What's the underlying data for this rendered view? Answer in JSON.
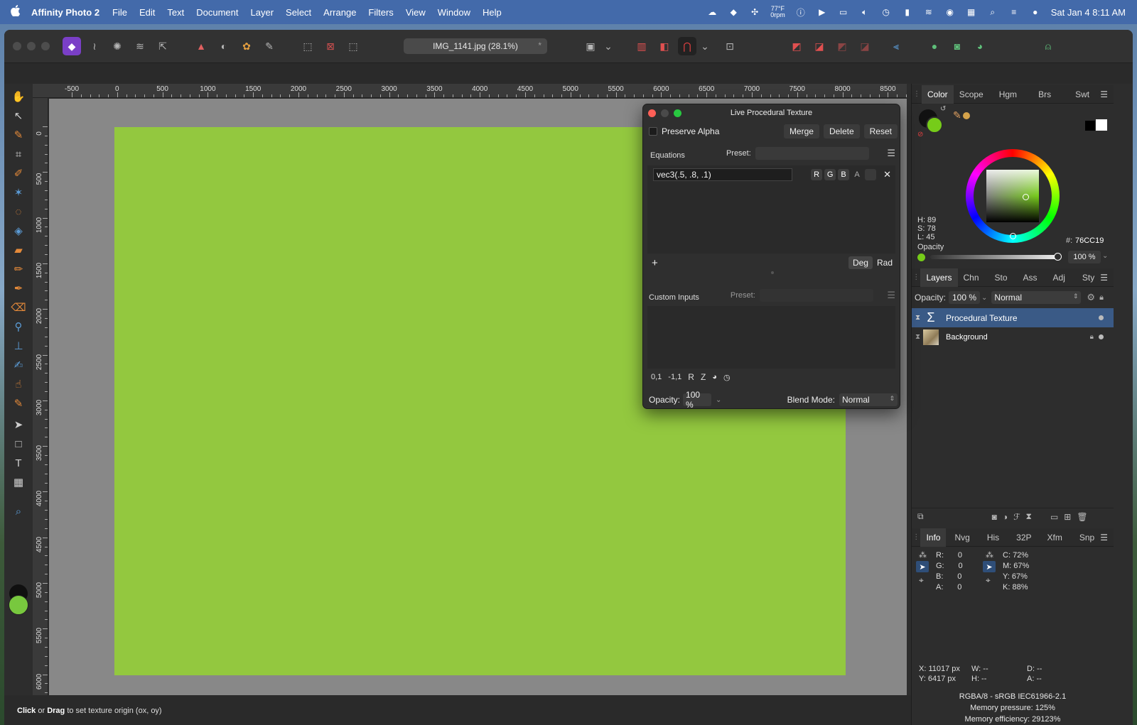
{
  "menubar": {
    "apple": "",
    "app_name": "Affinity Photo 2",
    "items": [
      "File",
      "Edit",
      "Text",
      "Document",
      "Layer",
      "Select",
      "Arrange",
      "Filters",
      "View",
      "Window",
      "Help"
    ],
    "weather_temp": "77°F",
    "weather_sub": "0rpm",
    "datetime": "Sat Jan 4  8:11 AM"
  },
  "toolbar": {
    "document_tab": "IMG_1141.jpg (28.1%)",
    "modified_mark": "*"
  },
  "rulers": {
    "unit": "px",
    "horizontal_labels": [
      "-500",
      "0",
      "500",
      "1000",
      "1500",
      "2000",
      "2500",
      "3000",
      "3500",
      "4000",
      "4500",
      "5000",
      "5500",
      "6000",
      "6500",
      "7000",
      "7500",
      "8000",
      "8500"
    ],
    "vertical_labels": [
      "0",
      "500",
      "1000",
      "1500",
      "2000",
      "2500",
      "3000",
      "3500",
      "4000",
      "4500",
      "5000",
      "5500",
      "6000"
    ]
  },
  "status": {
    "hint_bold1": "Click",
    "hint_mid": " or ",
    "hint_bold2": "Drag",
    "hint_rest": " to set texture origin (ox, oy)"
  },
  "dialog": {
    "title": "Live Procedural Texture",
    "preserve_alpha": "Preserve Alpha",
    "merge": "Merge",
    "delete": "Delete",
    "reset": "Reset",
    "equations_label": "Equations",
    "preset_label": "Preset:",
    "equation_value": "vec3(.5, .8, .1)",
    "channels": [
      "R",
      "G",
      "B",
      "A"
    ],
    "remove_icon": "✕",
    "add_icon": "+",
    "deg": "Deg",
    "rad": "Rad",
    "custom_inputs_label": "Custom Inputs",
    "custom_preset_label": "Preset:",
    "input_ops": [
      "0,1",
      "-1,1",
      "R",
      "Z"
    ],
    "opacity_label": "Opacity:",
    "opacity_value": "100 %",
    "blend_label": "Blend Mode:",
    "blend_value": "Normal"
  },
  "color_panel": {
    "tabs": [
      "Color",
      "Scope",
      "Hgm",
      "Brs",
      "Swt"
    ],
    "h": "H: 89",
    "s": "S: 78",
    "l": "L: 45",
    "hex_label": "#:",
    "hex_value": "76CC19",
    "opacity_label": "Opacity",
    "opacity_value": "100 %",
    "fill_color": "#76cc19"
  },
  "layers_panel": {
    "tabs": [
      "Layers",
      "Chn",
      "Sto",
      "Ass",
      "Adj",
      "Sty"
    ],
    "opacity_label": "Opacity:",
    "opacity_value": "100 %",
    "blend_mode": "Normal",
    "layers": [
      {
        "name": "Procedural Texture",
        "icon": "sigma-icon",
        "selected": true
      },
      {
        "name": "Background",
        "icon": "image-thumbnail",
        "selected": false
      }
    ]
  },
  "info_panel": {
    "tabs": [
      "Info",
      "Nvg",
      "His",
      "32P",
      "Xfm",
      "Snp"
    ],
    "rgba": [
      {
        "label": "R:",
        "value": "0"
      },
      {
        "label": "G:",
        "value": "0"
      },
      {
        "label": "B:",
        "value": "0"
      },
      {
        "label": "A:",
        "value": "0"
      }
    ],
    "cmyk": [
      {
        "label": "C:",
        "value": "72%"
      },
      {
        "label": "M:",
        "value": "67%"
      },
      {
        "label": "Y:",
        "value": "67%"
      },
      {
        "label": "K:",
        "value": "88%"
      }
    ],
    "x": "X: 11017 px",
    "y": "Y: 6417 px",
    "w": "W: --",
    "h": "H: --",
    "d": "D: --",
    "a": "A: --",
    "color_profile": "RGBA/8 - sRGB IEC61966-2.1",
    "memory_pressure": "Memory pressure: 125%",
    "memory_efficiency": "Memory efficiency: 29123%"
  }
}
